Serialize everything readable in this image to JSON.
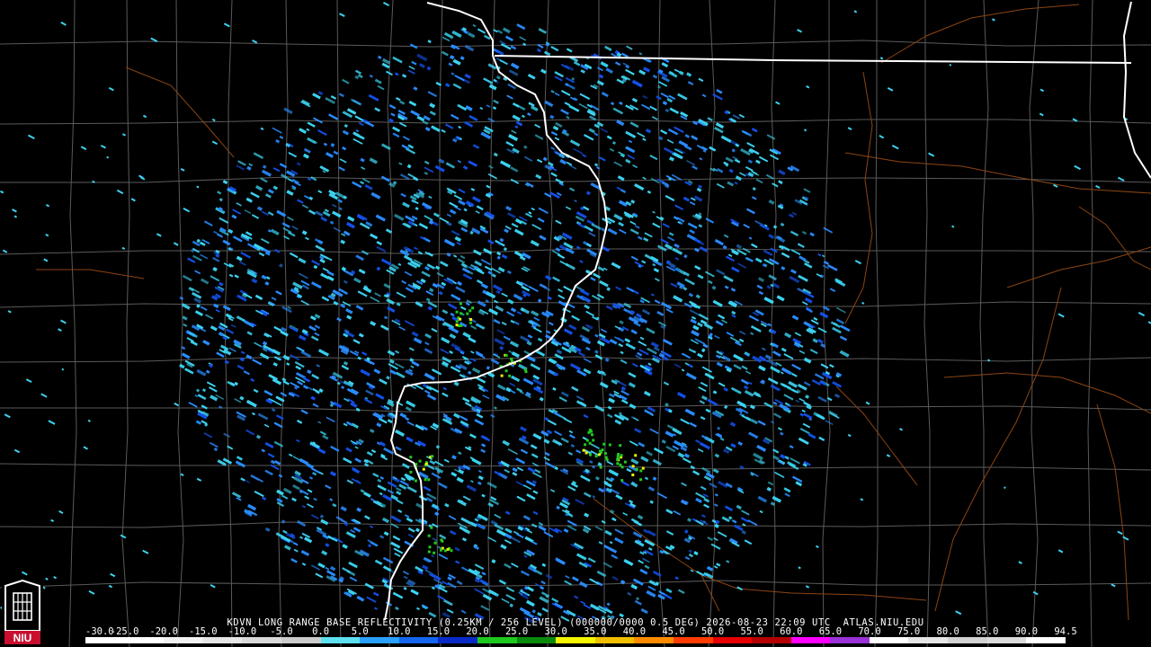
{
  "product": {
    "station": "KDVN",
    "description": "LONG RANGE BASE REFLECTIVITY",
    "resolution": "(0.25KM / 256 LEVEL)",
    "volume": "(000000/0000",
    "elevation": "0.5 DEG)",
    "timestamp": "2026-08-23 22:09 UTC",
    "source": "ATLAS.NIU.EDU"
  },
  "logo": {
    "text": "NIU",
    "icon": "niu-castle-icon"
  },
  "color_scale": {
    "labels": [
      "-30.0",
      "-25.0",
      "-20.0",
      "-15.0",
      "-10.0",
      "-5.0",
      "0.0",
      "5.0",
      "10.0",
      "15.0",
      "20.0",
      "25.0",
      "30.0",
      "35.0",
      "40.0",
      "45.0",
      "50.0",
      "55.0",
      "60.0",
      "65.0",
      "70.0",
      "75.0",
      "80.0",
      "85.0",
      "90.0",
      "94.5"
    ],
    "colors": [
      "#ffffff",
      "#ffffff",
      "#f2f2f2",
      "#e6e6e6",
      "#d9d9d9",
      "#cccccc",
      "#5ee0f0",
      "#2aa0ff",
      "#1464f0",
      "#0a2ac8",
      "#1ec81e",
      "#0a8a0a",
      "#f5f500",
      "#f0c000",
      "#ff8c00",
      "#ff3c00",
      "#e60000",
      "#b40000",
      "#ff00ff",
      "#9a32d6",
      "#ffffff",
      "#e6e6e6",
      "#d2d2d2",
      "#dcdcdc",
      "#ffffff"
    ]
  },
  "colors": {
    "background": "#000000",
    "county_lines": "#5a5a5a",
    "roads": "#8b4513",
    "state_border": "#ffffff",
    "echo_light": "#3cd2f0",
    "echo_mid": "#2a8cff",
    "echo_dark": "#1450e6",
    "echo_green": "#22c822",
    "echo_yellow": "#f0f000"
  },
  "radar": {
    "site": "KDVN",
    "range_km": 230
  }
}
